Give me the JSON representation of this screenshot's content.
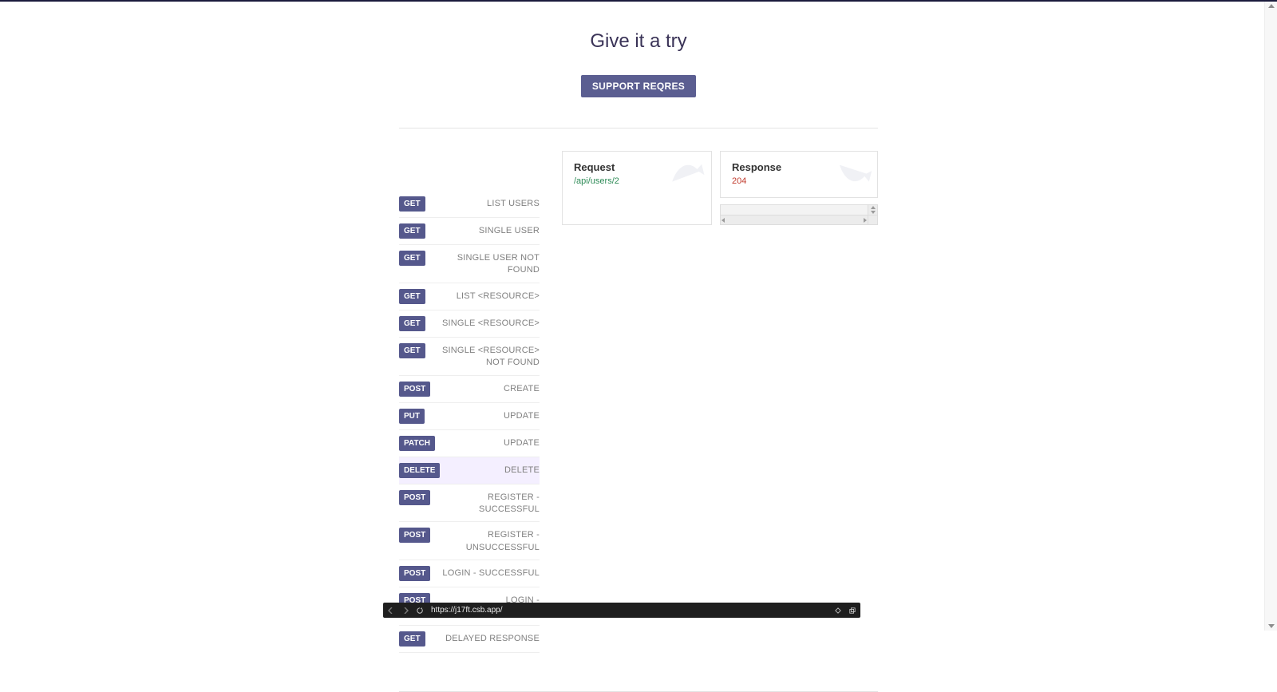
{
  "heading": "Give it a try",
  "support_button": "SUPPORT REQRES",
  "endpoints": [
    {
      "method": "GET",
      "label": "LIST USERS"
    },
    {
      "method": "GET",
      "label": "SINGLE USER"
    },
    {
      "method": "GET",
      "label": "SINGLE USER NOT FOUND"
    },
    {
      "method": "GET",
      "label": "LIST <RESOURCE>"
    },
    {
      "method": "GET",
      "label": "SINGLE <RESOURCE>"
    },
    {
      "method": "GET",
      "label": "SINGLE <RESOURCE> NOT FOUND"
    },
    {
      "method": "POST",
      "label": "CREATE"
    },
    {
      "method": "PUT",
      "label": "UPDATE"
    },
    {
      "method": "PATCH",
      "label": "UPDATE"
    },
    {
      "method": "DELETE",
      "label": "DELETE",
      "active": true
    },
    {
      "method": "POST",
      "label": "REGISTER - SUCCESSFUL"
    },
    {
      "method": "POST",
      "label": "REGISTER - UNSUCCESSFUL"
    },
    {
      "method": "POST",
      "label": "LOGIN - SUCCESSFUL"
    },
    {
      "method": "POST",
      "label": "LOGIN - UNSUCCESSFUL"
    },
    {
      "method": "GET",
      "label": "DELAYED RESPONSE"
    }
  ],
  "request": {
    "title": "Request",
    "path": "/api/users/2"
  },
  "response": {
    "title": "Response",
    "status": "204"
  },
  "footer": {
    "url": "https://j17ft.csb.app/"
  }
}
